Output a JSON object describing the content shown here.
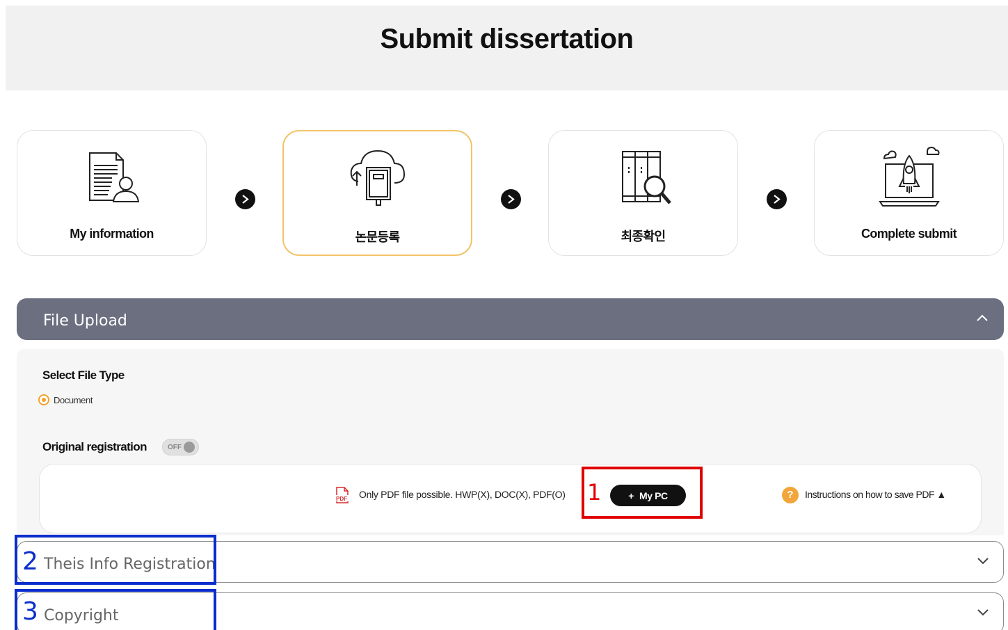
{
  "page": {
    "title": "Submit dissertation"
  },
  "steps": [
    {
      "label": "My information",
      "icon": "document-person-icon"
    },
    {
      "label": "논문등록",
      "icon": "cloud-upload-book-icon"
    },
    {
      "label": "최종확인",
      "icon": "books-magnifier-icon"
    },
    {
      "label": "Complete submit",
      "icon": "laptop-rocket-icon"
    }
  ],
  "file_upload": {
    "header": "File Upload",
    "file_type_label": "Select File Type",
    "file_type_option": "Document",
    "original_label": "Original registration",
    "toggle_state": "OFF",
    "hint": "Only PDF file possible. HWP(X), DOC(X), PDF(O)",
    "mypc_label": "My PC",
    "instructions": "Instructions on how to save PDF ▲",
    "help_glyph": "?"
  },
  "sections": [
    {
      "label": "Theis Info Registration"
    },
    {
      "label": "Copyright"
    }
  ],
  "annotations": [
    "1",
    "2",
    "3"
  ],
  "colors": {
    "active_border": "#f2c46a",
    "header_bg": "#6b6f80",
    "accent_orange": "#f2a22b",
    "annotation_red": "#e00000",
    "annotation_blue": "#0a2ecc"
  }
}
